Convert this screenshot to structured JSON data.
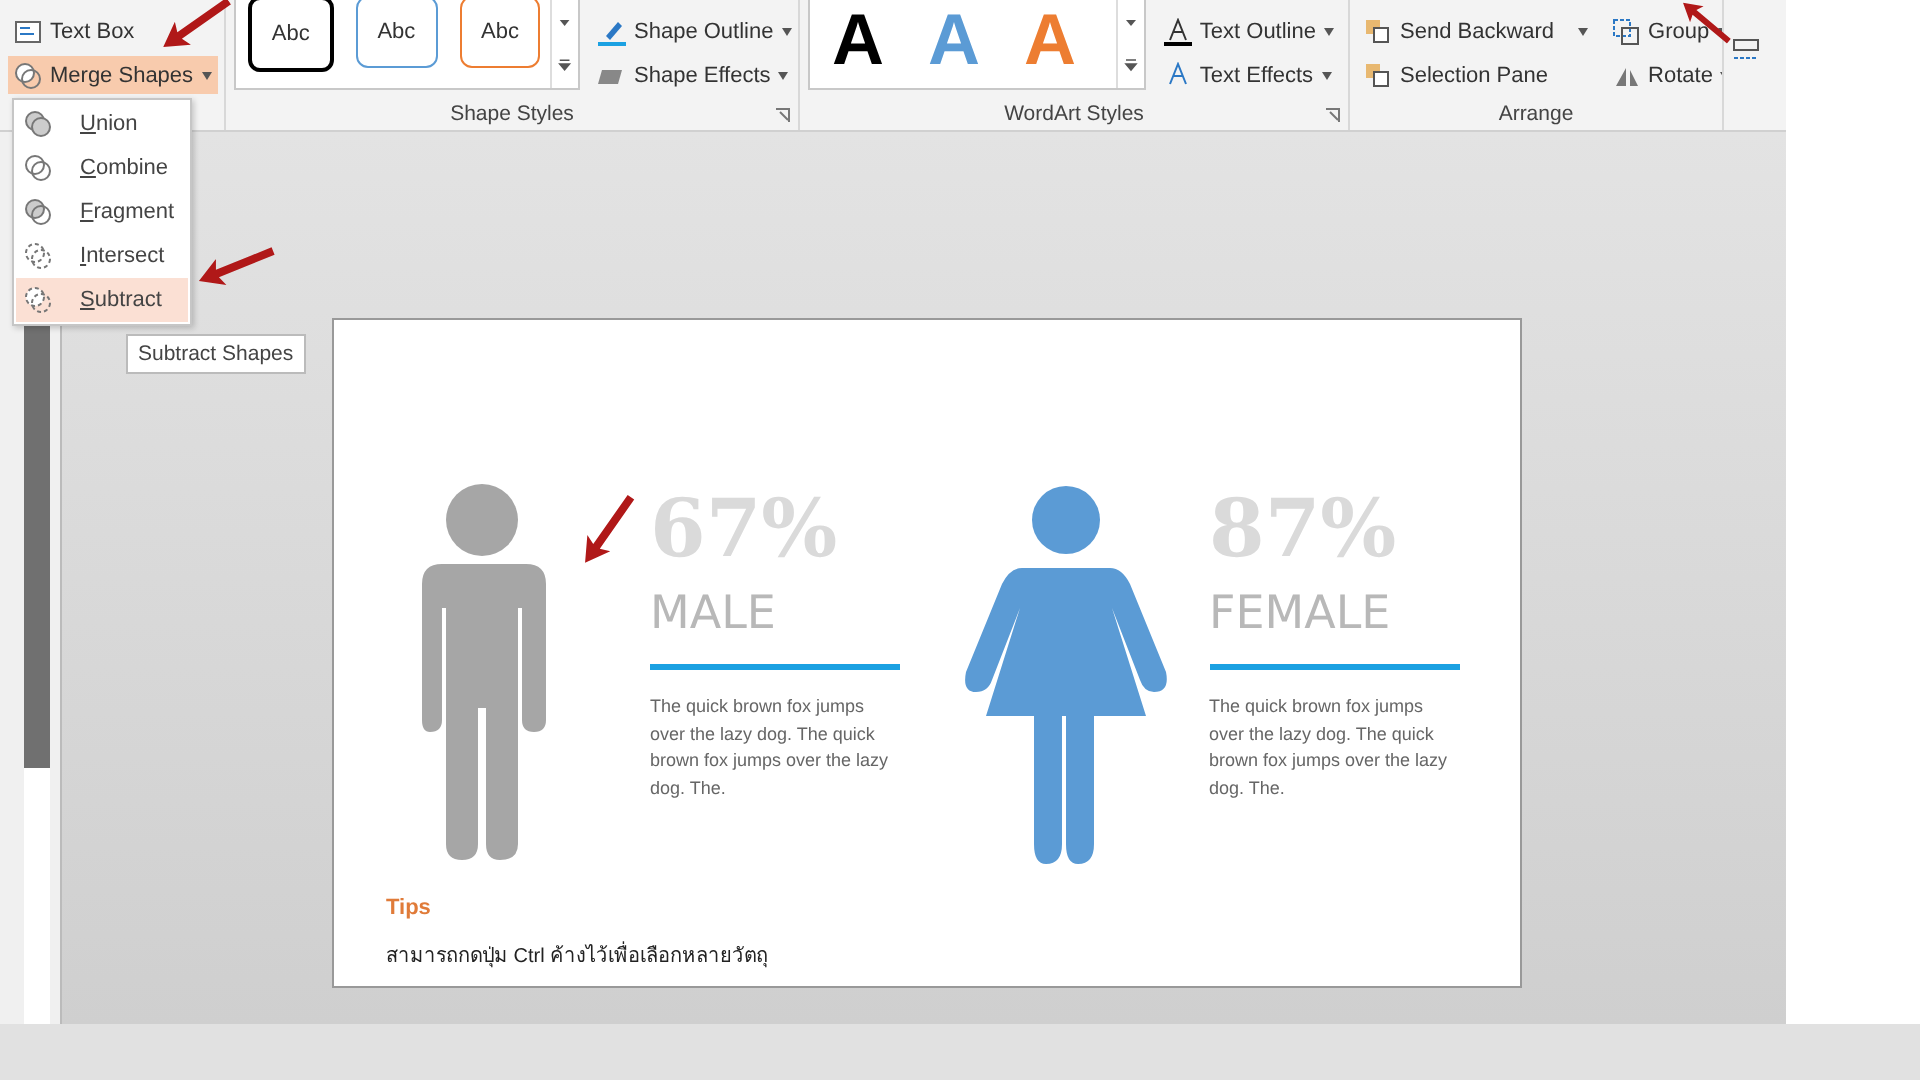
{
  "ribbon": {
    "insert_group": {
      "items": [
        {
          "label": "Text Box",
          "selected": false
        },
        {
          "label": "Merge Shapes",
          "selected": true
        }
      ]
    },
    "shape_styles": {
      "label": "Shape Styles",
      "gallery": [
        {
          "text": "Abc",
          "color": "#000000"
        },
        {
          "text": "Abc",
          "color": "#5b9bd5"
        },
        {
          "text": "Abc",
          "color": "#ed7d31"
        }
      ],
      "commands": [
        "Shape Outline",
        "Shape Effects"
      ]
    },
    "wordart_styles": {
      "label": "WordArt Styles",
      "gallery": [
        {
          "text": "A",
          "color": "#000000"
        },
        {
          "text": "A",
          "color": "#5b9bd5"
        },
        {
          "text": "A",
          "color": "#ed7d31"
        }
      ],
      "commands": [
        "Text Outline",
        "Text Effects"
      ]
    },
    "arrange": {
      "label": "Arrange",
      "commands": [
        "Send Backward",
        "Selection Pane",
        "Group",
        "Rotate"
      ]
    }
  },
  "merge_menu": {
    "items": [
      {
        "label": "Union",
        "selected": false
      },
      {
        "label": "Combine",
        "selected": false
      },
      {
        "label": "Fragment",
        "selected": false
      },
      {
        "label": "Intersect",
        "selected": false
      },
      {
        "label": "Subtract",
        "selected": true
      }
    ]
  },
  "tooltip": "Subtract Shapes",
  "slide": {
    "stats": [
      {
        "kind": "male",
        "color": "#a6a6a6",
        "percent": "67%",
        "label": "MALE",
        "text": "The quick brown fox jumps over the lazy dog. The quick brown fox jumps over the lazy dog. The."
      },
      {
        "kind": "female",
        "color": "#5b9bd5",
        "percent": "87%",
        "label": "FEMALE",
        "text": "The quick brown fox jumps over the lazy dog. The quick brown fox jumps over the lazy dog. The."
      }
    ],
    "tips_title": "Tips",
    "tips_text": "สามารถกดปุ่ม Ctrl ค้างไว้เพื่อเลือกหลายวัตถุ"
  }
}
